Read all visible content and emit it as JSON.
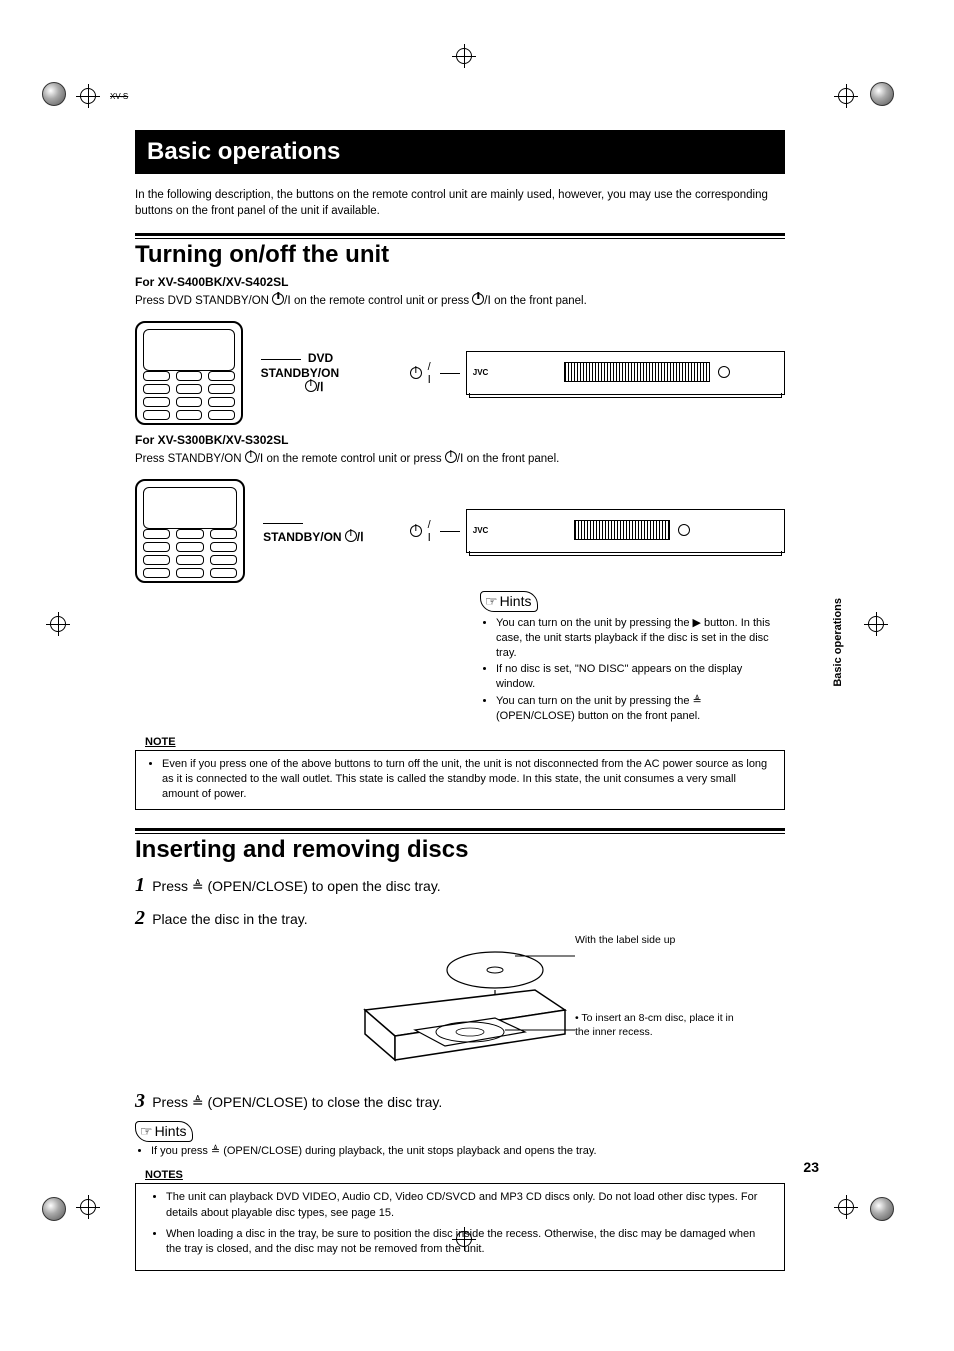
{
  "page_number": "23",
  "side_tab": "Basic operations",
  "top_crop_label": "XV-S",
  "title_bar": "Basic operations",
  "intro": "In the following description, the buttons on the remote control unit are mainly used, however, you may use the corresponding buttons on the front panel of the unit if available.",
  "section1": {
    "title": "Turning on/off the unit",
    "sub1": "For XV-S400BK/XV-S402SL",
    "para1_a": "Press DVD STANDBY/ON ",
    "para1_b": "/Ⅰ on the remote control unit or press ",
    "para1_c": "/Ⅰ on the front panel.",
    "callout1": "DVD STANDBY/ON",
    "callout1_sub": "/Ⅰ",
    "sub2": "For XV-S300BK/XV-S302SL",
    "para2_a": "Press STANDBY/ON ",
    "para2_b": "/Ⅰ on the remote control unit or press ",
    "para2_c": "/Ⅰ on the front panel.",
    "callout2": "STANDBY/ON",
    "callout2_sub": "/Ⅰ",
    "front_callout": "/Ⅰ",
    "hints_label": "Hints",
    "hints": [
      "You can turn on the unit by pressing the ▶ button. In this case, the unit starts playback if the disc is set in the disc tray.",
      "If no disc is set, \"NO DISC\" appears on the display window.",
      "You can turn on the unit by pressing the ≜ (OPEN/CLOSE) button on the front panel."
    ],
    "note_header": "NOTE",
    "note": "Even if you press one of the above buttons to turn off the unit, the unit is not disconnected from the AC power source as long as it is connected to the wall outlet. This state is called the standby mode.  In this state, the unit consumes a very small amount of power."
  },
  "section2": {
    "title": "Inserting and removing discs",
    "step1": "Press ≜ (OPEN/CLOSE) to open the disc tray.",
    "step2": "Place the disc in the tray.",
    "label_side_up": "With the label side up",
    "insert_tip": "• To insert an 8-cm disc, place it in the inner recess.",
    "step3": "Press ≜ (OPEN/CLOSE) to close the disc tray.",
    "hints_label": "Hints",
    "hints2": "If you press ≜ (OPEN/CLOSE) during playback, the unit stops playback and opens the tray.",
    "notes_header": "NOTES",
    "notes": [
      "The unit can playback DVD VIDEO, Audio CD, Video CD/SVCD and MP3 CD discs only.  Do not load other disc types. For details about playable disc types, see page 15.",
      "When loading a disc in the tray, be sure to position the disc inside the recess. Otherwise, the disc may be damaged when the tray is closed, and the disc may not be removed from the unit."
    ]
  }
}
